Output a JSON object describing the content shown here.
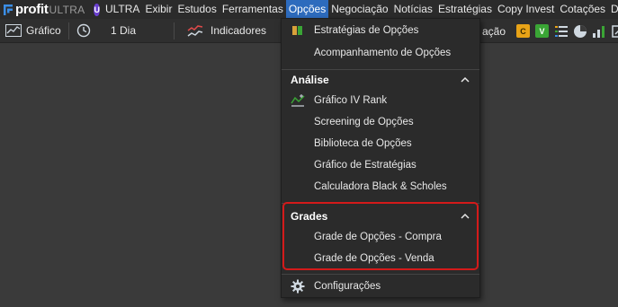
{
  "app": {
    "brand": "profit",
    "edition": "ULTRA",
    "plan_badge": "U",
    "plan_label": "ULTRA"
  },
  "menubar": {
    "items": [
      "Exibir",
      "Estudos",
      "Ferramentas",
      "Opções",
      "Negociação",
      "Notícias",
      "Estratégias",
      "Copy Invest",
      "Cotações",
      "Deskt"
    ],
    "active": "Opções"
  },
  "toolbar": {
    "chart_label": "Gráfico",
    "period_label": "1 Dia",
    "indicators_label": "Indicadores",
    "fragment_label": "ação",
    "badge_c": "C",
    "badge_v": "V"
  },
  "dropdown": {
    "top_items": [
      "Estratégias de Opções",
      "Acompanhamento de Opções"
    ],
    "analise": {
      "title": "Análise",
      "items": [
        "Gráfico IV Rank",
        "Screening de Opções",
        "Biblioteca de Opções",
        "Gráfico de Estratégias",
        "Calculadora Black & Scholes"
      ]
    },
    "grades": {
      "title": "Grades",
      "items": [
        "Grade de Opções - Compra",
        "Grade de Opções - Venda"
      ]
    },
    "settings_label": "Configurações"
  },
  "colors": {
    "menubar_bg": "#2b2b2b",
    "active_menu": "#2d6bbd",
    "highlight": "#d41a1a",
    "badge_c": "#e8a317",
    "badge_v": "#3aa535"
  }
}
